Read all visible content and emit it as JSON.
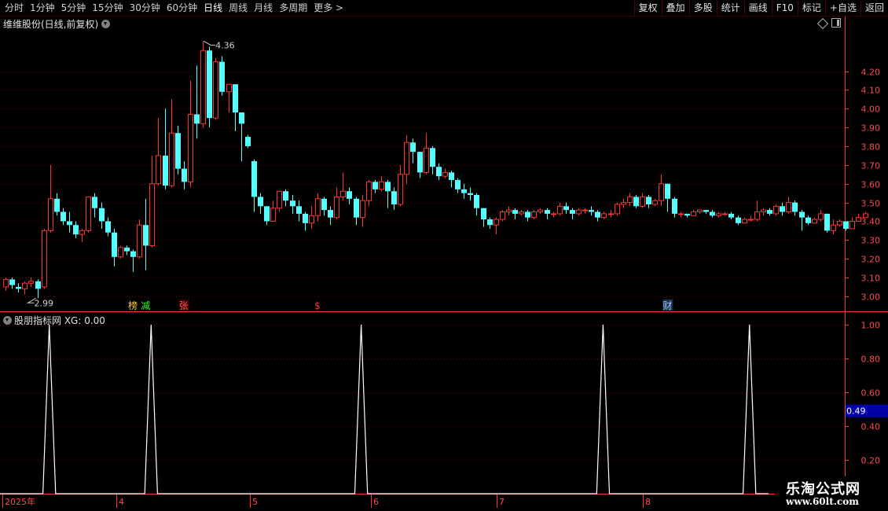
{
  "toolbar": {
    "periods": [
      "分时",
      "1分钟",
      "5分钟",
      "15分钟",
      "30分钟",
      "60分钟",
      "日线",
      "周线",
      "月线",
      "多周期",
      "更多 >"
    ],
    "active_period": "日线",
    "right_tools": [
      "复权",
      "叠加",
      "多股",
      "统计",
      "画线",
      "F10",
      "标记",
      "+自选",
      "返回"
    ]
  },
  "stock": {
    "title": "维维股份(日线,前复权)",
    "high_label": "4.36",
    "low_label": "2.99"
  },
  "indicator": {
    "title": "股朋指标网  XG: 0.00",
    "cursor_value": "0.49"
  },
  "events": [
    {
      "text": "榜",
      "color": "#ffcc33"
    },
    {
      "text": "减",
      "color": "#33ff33"
    },
    {
      "text": "张",
      "color": "#ff5a5a"
    },
    {
      "text": "$",
      "color": "#ff3333"
    },
    {
      "text": "财",
      "color": "#9ec9ff"
    }
  ],
  "watermark": {
    "line1": "乐淘公式网",
    "line2": "www.60lt.com"
  },
  "colors": {
    "up": "#ff3232",
    "down": "#54ffff",
    "grid": "#7a0000",
    "axis": "#ff3232",
    "text": "#ff4a4a",
    "indicator": "#ffffff"
  },
  "chart_data": [
    {
      "type": "candlestick",
      "title": "维维股份(日线,前复权)",
      "y_ticks": [
        3.0,
        3.1,
        3.2,
        3.3,
        3.4,
        3.5,
        3.6,
        3.7,
        3.8,
        3.9,
        4.0,
        4.1,
        4.2
      ],
      "ylim": [
        2.92,
        4.42
      ],
      "x_month_labels": [
        "2025年",
        "4",
        "5",
        "6",
        "7",
        "8"
      ],
      "candles": [
        [
          3.05,
          3.09,
          3.03,
          3.1
        ],
        [
          3.09,
          3.06,
          3.04,
          3.1
        ],
        [
          3.05,
          3.04,
          3.02,
          3.07
        ],
        [
          3.04,
          3.07,
          3.01,
          3.08
        ],
        [
          3.07,
          3.08,
          3.05,
          3.1
        ],
        [
          3.08,
          3.04,
          2.99,
          3.09
        ],
        [
          3.05,
          3.35,
          3.04,
          3.36
        ],
        [
          3.35,
          3.52,
          3.34,
          3.7
        ],
        [
          3.52,
          3.45,
          3.43,
          3.55
        ],
        [
          3.45,
          3.4,
          3.38,
          3.47
        ],
        [
          3.4,
          3.38,
          3.34,
          3.45
        ],
        [
          3.38,
          3.33,
          3.31,
          3.4
        ],
        [
          3.33,
          3.35,
          3.29,
          3.36
        ],
        [
          3.35,
          3.53,
          3.34,
          3.53
        ],
        [
          3.53,
          3.47,
          3.42,
          3.55
        ],
        [
          3.47,
          3.4,
          3.36,
          3.5
        ],
        [
          3.4,
          3.34,
          3.32,
          3.42
        ],
        [
          3.34,
          3.21,
          3.16,
          3.36
        ],
        [
          3.21,
          3.26,
          3.2,
          3.27
        ],
        [
          3.26,
          3.24,
          3.22,
          3.27
        ],
        [
          3.24,
          3.21,
          3.13,
          3.25
        ],
        [
          3.21,
          3.38,
          3.2,
          3.41
        ],
        [
          3.38,
          3.27,
          3.14,
          3.52
        ],
        [
          3.27,
          3.6,
          3.26,
          3.75
        ],
        [
          3.6,
          3.75,
          3.59,
          3.95
        ],
        [
          3.75,
          3.59,
          3.57,
          4.0
        ],
        [
          3.59,
          3.87,
          3.58,
          4.05
        ],
        [
          3.87,
          3.68,
          3.65,
          3.91
        ],
        [
          3.68,
          3.61,
          3.57,
          3.72
        ],
        [
          3.61,
          3.97,
          3.58,
          4.15
        ],
        [
          3.97,
          3.92,
          3.84,
          4.23
        ],
        [
          3.92,
          4.31,
          3.9,
          4.36
        ],
        [
          4.31,
          3.95,
          3.9,
          4.33
        ],
        [
          3.95,
          4.25,
          3.94,
          4.27
        ],
        [
          4.25,
          4.09,
          4.07,
          4.28
        ],
        [
          4.09,
          4.13,
          3.98,
          4.13
        ],
        [
          4.13,
          3.98,
          3.88,
          4.13
        ],
        [
          3.98,
          3.92,
          3.72,
          3.98
        ],
        [
          3.85,
          3.8,
          3.79,
          3.86
        ],
        [
          3.72,
          3.53,
          3.45,
          3.73
        ],
        [
          3.53,
          3.48,
          3.44,
          3.55
        ],
        [
          3.48,
          3.4,
          3.38,
          3.48
        ],
        [
          3.4,
          3.47,
          3.4,
          3.51
        ],
        [
          3.47,
          3.56,
          3.45,
          3.56
        ],
        [
          3.56,
          3.51,
          3.48,
          3.57
        ],
        [
          3.51,
          3.48,
          3.44,
          3.54
        ],
        [
          3.48,
          3.44,
          3.4,
          3.51
        ],
        [
          3.44,
          3.39,
          3.35,
          3.45
        ],
        [
          3.39,
          3.43,
          3.36,
          3.48
        ],
        [
          3.43,
          3.52,
          3.4,
          3.55
        ],
        [
          3.52,
          3.46,
          3.43,
          3.53
        ],
        [
          3.46,
          3.42,
          3.38,
          3.48
        ],
        [
          3.42,
          3.53,
          3.41,
          3.58
        ],
        [
          3.53,
          3.56,
          3.51,
          3.66
        ],
        [
          3.56,
          3.52,
          3.49,
          3.58
        ],
        [
          3.52,
          3.42,
          3.38,
          3.53
        ],
        [
          3.42,
          3.51,
          3.37,
          3.54
        ],
        [
          3.51,
          3.61,
          3.48,
          3.62
        ],
        [
          3.61,
          3.57,
          3.55,
          3.62
        ],
        [
          3.57,
          3.61,
          3.56,
          3.64
        ],
        [
          3.61,
          3.56,
          3.47,
          3.62
        ],
        [
          3.56,
          3.49,
          3.46,
          3.58
        ],
        [
          3.49,
          3.65,
          3.48,
          3.7
        ],
        [
          3.65,
          3.82,
          3.6,
          3.86
        ],
        [
          3.82,
          3.77,
          3.71,
          3.84
        ],
        [
          3.77,
          3.66,
          3.63,
          3.77
        ],
        [
          3.66,
          3.79,
          3.65,
          3.87
        ],
        [
          3.79,
          3.69,
          3.65,
          3.8
        ],
        [
          3.69,
          3.64,
          3.62,
          3.71
        ],
        [
          3.64,
          3.66,
          3.63,
          3.68
        ],
        [
          3.66,
          3.62,
          3.58,
          3.67
        ],
        [
          3.62,
          3.57,
          3.55,
          3.63
        ],
        [
          3.57,
          3.55,
          3.52,
          3.6
        ],
        [
          3.55,
          3.54,
          3.51,
          3.58
        ],
        [
          3.54,
          3.47,
          3.43,
          3.55
        ],
        [
          3.47,
          3.41,
          3.37,
          3.47
        ],
        [
          3.41,
          3.38,
          3.36,
          3.42
        ],
        [
          3.38,
          3.41,
          3.33,
          3.42
        ],
        [
          3.41,
          3.45,
          3.4,
          3.46
        ],
        [
          3.45,
          3.46,
          3.43,
          3.48
        ],
        [
          3.46,
          3.44,
          3.41,
          3.47
        ],
        [
          3.44,
          3.45,
          3.43,
          3.46
        ],
        [
          3.45,
          3.42,
          3.4,
          3.46
        ],
        [
          3.42,
          3.45,
          3.41,
          3.46
        ],
        [
          3.45,
          3.46,
          3.44,
          3.47
        ],
        [
          3.46,
          3.44,
          3.41,
          3.47
        ],
        [
          3.44,
          3.44,
          3.42,
          3.45
        ],
        [
          3.44,
          3.48,
          3.43,
          3.5
        ],
        [
          3.48,
          3.46,
          3.44,
          3.5
        ],
        [
          3.46,
          3.44,
          3.41,
          3.47
        ],
        [
          3.44,
          3.46,
          3.43,
          3.47
        ],
        [
          3.46,
          3.46,
          3.44,
          3.47
        ],
        [
          3.46,
          3.45,
          3.43,
          3.48
        ],
        [
          3.45,
          3.42,
          3.4,
          3.46
        ],
        [
          3.42,
          3.44,
          3.41,
          3.45
        ],
        [
          3.44,
          3.44,
          3.42,
          3.46
        ],
        [
          3.44,
          3.49,
          3.43,
          3.5
        ],
        [
          3.49,
          3.5,
          3.47,
          3.52
        ],
        [
          3.5,
          3.53,
          3.48,
          3.55
        ],
        [
          3.53,
          3.48,
          3.47,
          3.54
        ],
        [
          3.48,
          3.53,
          3.47,
          3.55
        ],
        [
          3.53,
          3.49,
          3.47,
          3.54
        ],
        [
          3.49,
          3.51,
          3.48,
          3.52
        ],
        [
          3.51,
          3.6,
          3.48,
          3.65
        ],
        [
          3.6,
          3.52,
          3.45,
          3.6
        ],
        [
          3.52,
          3.44,
          3.42,
          3.53
        ],
        [
          3.44,
          3.44,
          3.42,
          3.45
        ],
        [
          3.44,
          3.43,
          3.42,
          3.44
        ],
        [
          3.43,
          3.45,
          3.43,
          3.46
        ],
        [
          3.45,
          3.46,
          3.44,
          3.46
        ],
        [
          3.46,
          3.45,
          3.44,
          3.46
        ],
        [
          3.45,
          3.43,
          3.42,
          3.46
        ],
        [
          3.43,
          3.44,
          3.42,
          3.45
        ],
        [
          3.44,
          3.44,
          3.43,
          3.45
        ],
        [
          3.44,
          3.42,
          3.41,
          3.45
        ],
        [
          3.42,
          3.39,
          3.38,
          3.43
        ],
        [
          3.39,
          3.41,
          3.39,
          3.42
        ],
        [
          3.41,
          3.41,
          3.4,
          3.43
        ],
        [
          3.41,
          3.45,
          3.4,
          3.51
        ],
        [
          3.45,
          3.46,
          3.43,
          3.47
        ],
        [
          3.46,
          3.44,
          3.43,
          3.47
        ],
        [
          3.44,
          3.48,
          3.43,
          3.49
        ],
        [
          3.48,
          3.45,
          3.43,
          3.5
        ],
        [
          3.45,
          3.5,
          3.44,
          3.53
        ],
        [
          3.5,
          3.45,
          3.43,
          3.51
        ],
        [
          3.45,
          3.42,
          3.35,
          3.46
        ],
        [
          3.42,
          3.39,
          3.38,
          3.43
        ],
        [
          3.39,
          3.41,
          3.39,
          3.42
        ],
        [
          3.41,
          3.44,
          3.4,
          3.46
        ],
        [
          3.44,
          3.35,
          3.34,
          3.44
        ],
        [
          3.35,
          3.38,
          3.33,
          3.41
        ],
        [
          3.38,
          3.4,
          3.37,
          3.41
        ],
        [
          3.4,
          3.36,
          3.35,
          3.4
        ],
        [
          3.36,
          3.4,
          3.36,
          3.42
        ],
        [
          3.4,
          3.42,
          3.4,
          3.44
        ],
        [
          3.42,
          3.44,
          3.42,
          3.45
        ]
      ]
    },
    {
      "type": "line",
      "title": "股朋指标网  XG: 0.00",
      "y_ticks": [
        0.2,
        0.4,
        0.6,
        0.8,
        1.0
      ],
      "ylim": [
        0,
        1.07
      ],
      "spikes_at_candle_index": [
        7,
        23,
        56,
        94,
        117
      ],
      "series": [
        {
          "name": "XG",
          "values": "0 everywhere, 1.00 at spike candles"
        }
      ]
    }
  ]
}
